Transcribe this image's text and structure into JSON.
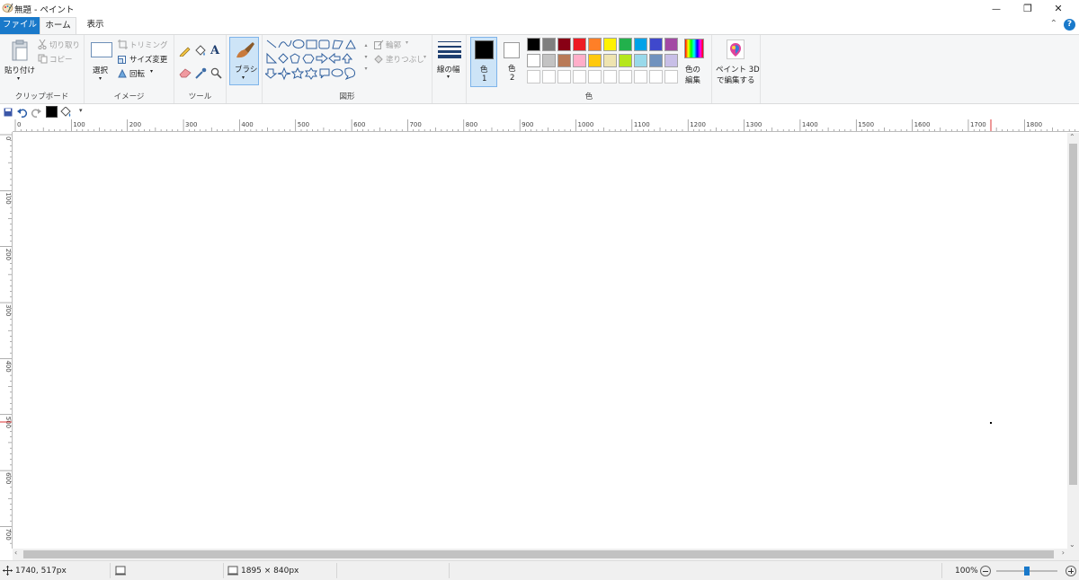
{
  "window": {
    "title": "無題 - ペイント",
    "minimize_glyph": "—",
    "maximize_glyph": "❐",
    "close_glyph": "✕"
  },
  "tabs": {
    "file": "ファイル",
    "home": "ホーム",
    "view": "表示"
  },
  "help": {
    "collapse_glyph": "⌃",
    "help_glyph": "?"
  },
  "clipboard": {
    "paste": "貼り付け",
    "cut": "切り取り",
    "copy": "コピー",
    "group": "クリップボード"
  },
  "image": {
    "select": "選択",
    "crop": "トリミング",
    "resize": "サイズ変更",
    "rotate": "回転",
    "group": "イメージ"
  },
  "tools": {
    "group": "ツール",
    "text_glyph": "A"
  },
  "brushes": {
    "label": "ブラシ"
  },
  "shapes": {
    "outline": "輪郭",
    "fill": "塗りつぶし",
    "group": "図形"
  },
  "size": {
    "label": "線の幅"
  },
  "colors": {
    "color1_label": "色",
    "color1_num": "1",
    "color2_label": "色",
    "color2_num": "2",
    "edit_line1": "色の",
    "edit_line2": "編集",
    "group": "色",
    "color1_value": "#000000",
    "color2_value": "#ffffff",
    "palette_row1": [
      "#000000",
      "#7f7f7f",
      "#880015",
      "#ed1c24",
      "#ff7f27",
      "#fff200",
      "#22b14c",
      "#00a2e8",
      "#3f48cc",
      "#a349a4"
    ],
    "palette_row2": [
      "#ffffff",
      "#c3c3c3",
      "#b97a57",
      "#ffaec9",
      "#ffc90e",
      "#efe4b0",
      "#b5e61d",
      "#99d9ea",
      "#7092be",
      "#c8bfe7"
    ],
    "palette_row3": [
      "#ffffff",
      "#ffffff",
      "#ffffff",
      "#ffffff",
      "#ffffff",
      "#ffffff",
      "#ffffff",
      "#ffffff",
      "#ffffff",
      "#ffffff"
    ]
  },
  "paint3d": {
    "line1": "ペイント 3D",
    "line2": "で編集する"
  },
  "rulers": {
    "h_ticks": [
      "0",
      "100",
      "200",
      "300",
      "400",
      "500",
      "600",
      "700",
      "800",
      "900",
      "1000",
      "1100",
      "1200",
      "1300",
      "1400",
      "1500",
      "1600",
      "1700",
      "1800"
    ],
    "v_ticks": [
      "0",
      "100",
      "200",
      "300",
      "400",
      "500",
      "600",
      "700"
    ]
  },
  "status": {
    "cursor_pos": "1740, 517px",
    "image_size": "1895 × 840px",
    "zoom": "100%",
    "zoom_level": 1.0
  },
  "accent": "#1979ca"
}
